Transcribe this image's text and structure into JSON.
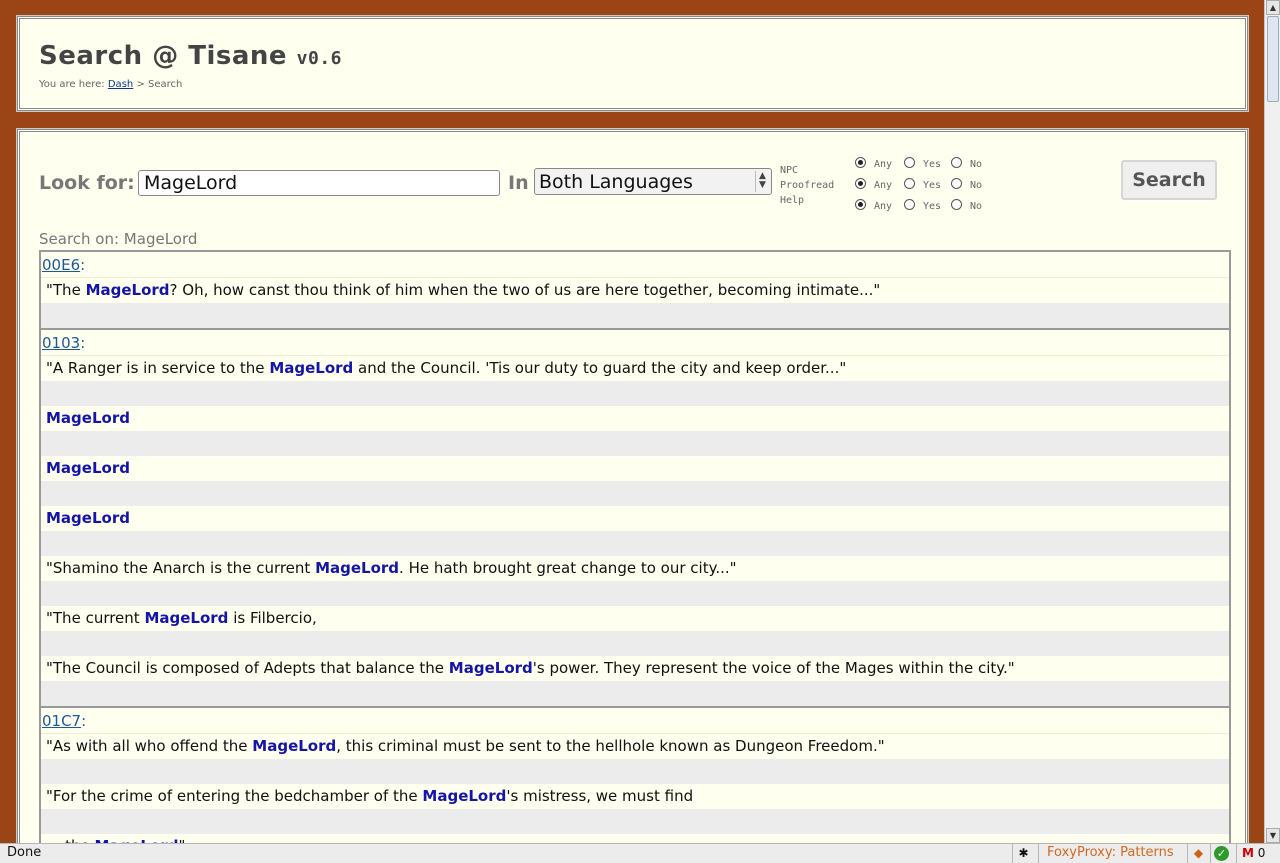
{
  "header": {
    "title": "Search @ Tisane",
    "version": "v0.6",
    "crumb_prefix": "You are here:",
    "crumb_link": "Dash",
    "crumb_sep": ">",
    "crumb_current": "Search"
  },
  "form": {
    "look_for_label": "Look for:",
    "query_value": "MageLord",
    "in_label": "In",
    "language_selected": "Both Languages",
    "flags": [
      {
        "label": "NPC",
        "selected": "Any"
      },
      {
        "label": "Proofread",
        "selected": "Any"
      },
      {
        "label": "Help",
        "selected": "Any"
      }
    ],
    "flag_options": [
      "Any",
      "Yes",
      "No"
    ],
    "search_button": "Search"
  },
  "search_on": "Search on: MageLord",
  "results": [
    {
      "id": "00E6",
      "entries": [
        {
          "pre": "\"The ",
          "hl": "MageLord",
          "post": "? Oh, how canst thou think of him when the two of us are here together, becoming intimate...\""
        }
      ]
    },
    {
      "id": "0103",
      "entries": [
        {
          "pre": "\"A Ranger is in service to the ",
          "hl": "MageLord",
          "post": " and the Council. 'Tis our duty to guard the city and keep order...\""
        },
        {
          "pre": "",
          "hl": "MageLord",
          "post": ""
        },
        {
          "pre": "",
          "hl": "MageLord",
          "post": ""
        },
        {
          "pre": "",
          "hl": "MageLord",
          "post": ""
        },
        {
          "pre": "\"Shamino the Anarch is the current ",
          "hl": "MageLord",
          "post": ". He hath brought great change to our city...\""
        },
        {
          "pre": "\"The current ",
          "hl": "MageLord",
          "post": " is Filbercio,"
        },
        {
          "pre": "\"The Council is composed of Adepts that balance the ",
          "hl": "MageLord",
          "post": "'s power. They represent the voice of the Mages within the city.\""
        }
      ]
    },
    {
      "id": "01C7",
      "entries": [
        {
          "pre": "\"As with all who offend the ",
          "hl": "MageLord",
          "post": ", this criminal must be sent to the hellhole known as Dungeon Freedom.\""
        },
        {
          "pre": "\"For the crime of entering the bedchamber of the ",
          "hl": "MageLord",
          "post": "'s mistress, we must find"
        },
        {
          "pre": "... the ",
          "hl": "MageLord",
          "post": "\""
        }
      ]
    }
  ],
  "statusbar": {
    "status": "Done",
    "foxyproxy": "FoxyProxy: Patterns",
    "mail_count": "0"
  },
  "icons": {
    "bug": "bug-icon",
    "foxy": "fox-icon",
    "check": "check-icon",
    "mail": "gmail-icon"
  }
}
